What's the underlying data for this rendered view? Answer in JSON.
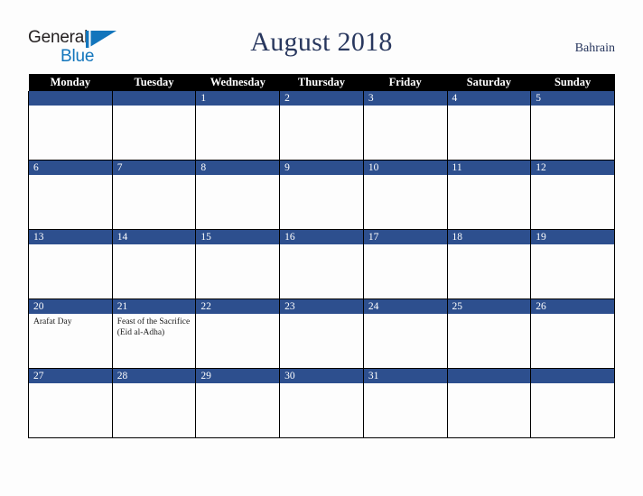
{
  "brand": {
    "name_part1": "General",
    "name_part2": "Blue",
    "mark": "flag-triangle-icon",
    "color_dark": "#231f20",
    "color_blue": "#1275bc"
  },
  "header": {
    "title": "August 2018",
    "country": "Bahrain",
    "title_color": "#28375e"
  },
  "colors": {
    "weekday_header_bg": "#000000",
    "weekday_header_text": "#ffffff",
    "daynumber_band_bg": "#2d4f8e",
    "daynumber_text": "#ffffff",
    "cell_bg": "#fdfdfd",
    "grid_line": "#000000",
    "page_bg": "#fdfdfd"
  },
  "weekdays": [
    "Monday",
    "Tuesday",
    "Wednesday",
    "Thursday",
    "Friday",
    "Saturday",
    "Sunday"
  ],
  "weeks": [
    [
      {
        "day": "",
        "event": ""
      },
      {
        "day": "",
        "event": ""
      },
      {
        "day": "1",
        "event": ""
      },
      {
        "day": "2",
        "event": ""
      },
      {
        "day": "3",
        "event": ""
      },
      {
        "day": "4",
        "event": ""
      },
      {
        "day": "5",
        "event": ""
      }
    ],
    [
      {
        "day": "6",
        "event": ""
      },
      {
        "day": "7",
        "event": ""
      },
      {
        "day": "8",
        "event": ""
      },
      {
        "day": "9",
        "event": ""
      },
      {
        "day": "10",
        "event": ""
      },
      {
        "day": "11",
        "event": ""
      },
      {
        "day": "12",
        "event": ""
      }
    ],
    [
      {
        "day": "13",
        "event": ""
      },
      {
        "day": "14",
        "event": ""
      },
      {
        "day": "15",
        "event": ""
      },
      {
        "day": "16",
        "event": ""
      },
      {
        "day": "17",
        "event": ""
      },
      {
        "day": "18",
        "event": ""
      },
      {
        "day": "19",
        "event": ""
      }
    ],
    [
      {
        "day": "20",
        "event": "Arafat Day"
      },
      {
        "day": "21",
        "event": "Feast of the Sacrifice (Eid al-Adha)"
      },
      {
        "day": "22",
        "event": ""
      },
      {
        "day": "23",
        "event": ""
      },
      {
        "day": "24",
        "event": ""
      },
      {
        "day": "25",
        "event": ""
      },
      {
        "day": "26",
        "event": ""
      }
    ],
    [
      {
        "day": "27",
        "event": ""
      },
      {
        "day": "28",
        "event": ""
      },
      {
        "day": "29",
        "event": ""
      },
      {
        "day": "30",
        "event": ""
      },
      {
        "day": "31",
        "event": ""
      },
      {
        "day": "",
        "event": ""
      },
      {
        "day": "",
        "event": ""
      }
    ]
  ]
}
